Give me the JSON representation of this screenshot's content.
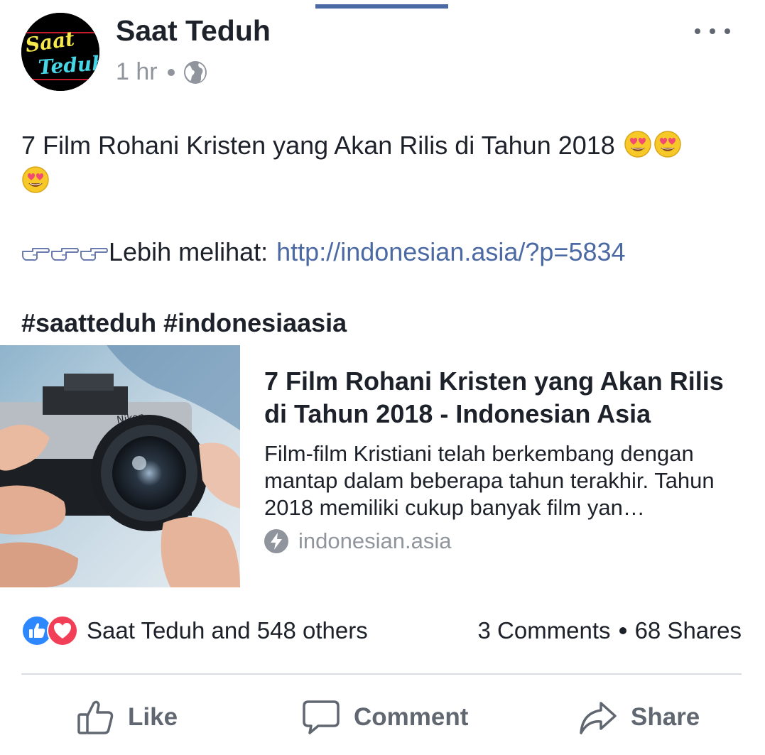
{
  "post": {
    "page_name": "Saat Teduh",
    "avatar_lines": [
      "Saat",
      "Teduh"
    ],
    "time": "1 hr",
    "privacy_icon": "globe-icon",
    "text": "7 Film Rohani Kristen yang Akan Rilis di Tahun 2018",
    "emojis": [
      "heart-eyes-emoji",
      "heart-eyes-emoji",
      "heart-eyes-emoji"
    ],
    "link_prefix_icons": [
      "pointing-hand-icon",
      "pointing-hand-icon",
      "pointing-hand-icon"
    ],
    "link_prefix": "Lebih melihat:",
    "link_url": "http://indonesian.asia/?p=5834",
    "hashtags": [
      "#saatteduh",
      "#indonesiaasia"
    ]
  },
  "link_card": {
    "title": "7 Film Rohani Kristen yang Akan Rilis di Tahun 2018 - Indonesian Asia",
    "description": "Film-film Kristiani telah berkembang dengan mantap dalam beberapa tahun terakhir. Tahun 2018 memiliki cukup banyak film yan…",
    "domain": "indonesian.asia",
    "image_text": "Nikon"
  },
  "stats": {
    "reactions_text": "Saat Teduh and 548 others",
    "comments": "3 Comments",
    "shares": "68 Shares"
  },
  "actions": {
    "like": "Like",
    "comment": "Comment",
    "share": "Share"
  },
  "colors": {
    "link": "#4b6aa4",
    "like_blue": "#2d88ff",
    "love_red": "#f33e58",
    "muted": "#90949c"
  }
}
